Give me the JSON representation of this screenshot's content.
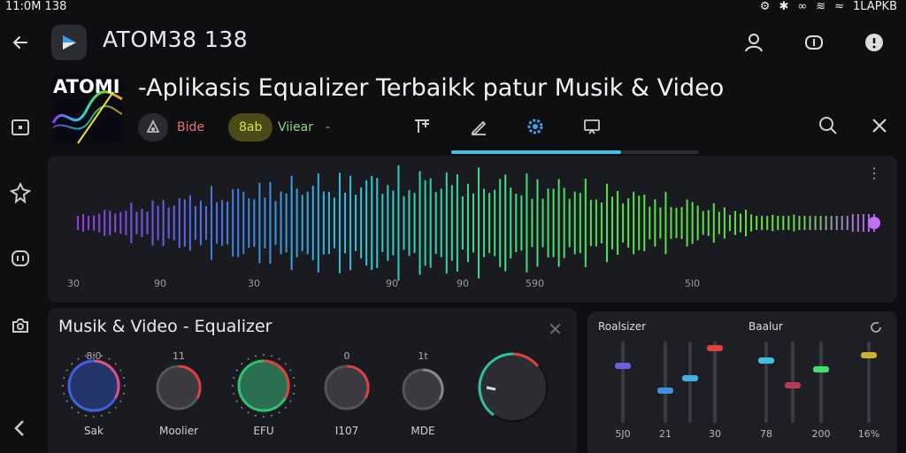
{
  "status": {
    "time": "11:0M 138",
    "right": "1LAPKB"
  },
  "app": {
    "title": "ATOM38 138"
  },
  "headline": {
    "thumb_label": "ATOMI",
    "text": "-Aplikasis Equalizer Terbaikk patur Musik & Video"
  },
  "toolbar": {
    "chip_music": "Bide",
    "chip_pill": "8ab",
    "chip_video": "Viiear",
    "chip_caret": "-"
  },
  "waveform": {
    "ticks": [
      "30",
      "90",
      "30",
      "90",
      "90",
      "590",
      "5l0"
    ]
  },
  "equalizer": {
    "title": "Musik & Video - Equalizer",
    "knobs": [
      {
        "label": "Sak",
        "top": "8i0"
      },
      {
        "label": "Moolier",
        "top": "11"
      },
      {
        "label": "EFU",
        "top": ""
      },
      {
        "label": "I107",
        "top": "0"
      },
      {
        "label": "MDE",
        "top": "1t"
      }
    ]
  },
  "mixer": {
    "header_left": "Roalsizer",
    "header_mid": "Baalur",
    "faders": [
      {
        "value": "5J0"
      },
      {
        "value": "21"
      },
      {
        "value": ""
      },
      {
        "value": "30"
      },
      {
        "value": "78"
      },
      {
        "value": ""
      },
      {
        "value": "200"
      },
      {
        "value": "16%"
      }
    ]
  },
  "colors": {
    "accent": "#3fc0e8",
    "pill": "#d4e23a",
    "panel": "#1a1b20"
  }
}
